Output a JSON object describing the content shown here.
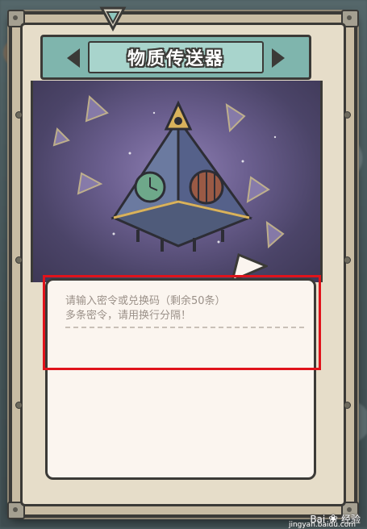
{
  "card": {
    "title": "物质传送器"
  },
  "input": {
    "placeholder_line1": "请输入密令或兑换码（剩余50条）",
    "placeholder_line2": "多条密令，请用换行分隔！",
    "value": ""
  },
  "watermark": {
    "brand": "Bai",
    "brand2": "经验",
    "url": "jingyan.baidu.com"
  },
  "colors": {
    "frame": "#c9bca3",
    "banner": "#7fb5ad",
    "art_bg": "#6b5f8f",
    "textbox_bg": "#fbf5ef",
    "highlight": "#e0131b"
  }
}
